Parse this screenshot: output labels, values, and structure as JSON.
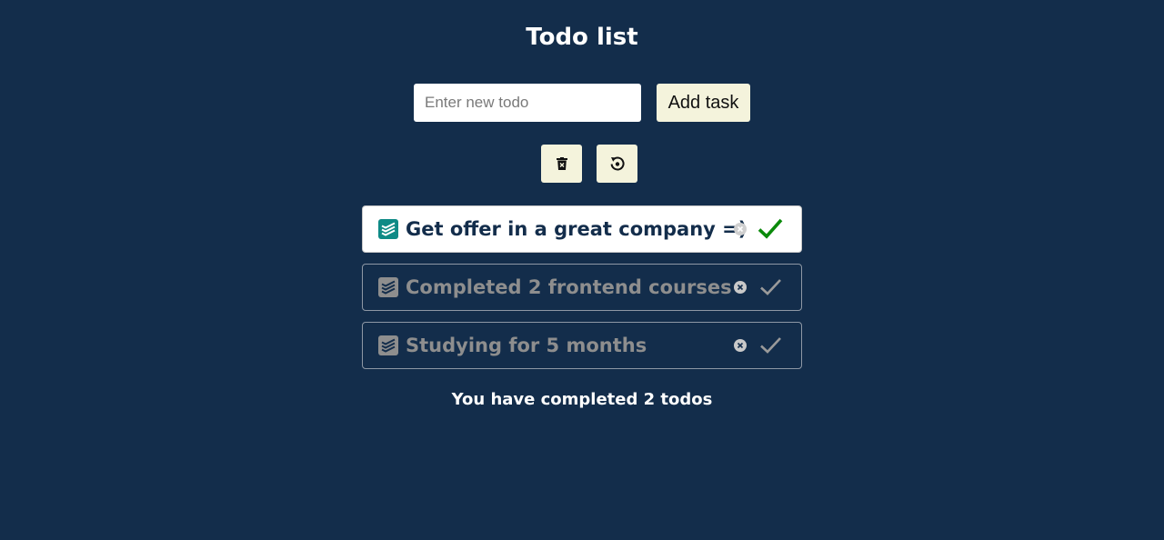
{
  "header": {
    "title": "Todo list"
  },
  "form": {
    "input_placeholder": "Enter new todo",
    "input_value": "",
    "add_label": "Add task"
  },
  "toolbar": {
    "delete_icon": "trash-icon",
    "reset_icon": "reset-icon"
  },
  "todos": [
    {
      "text": "Get offer in a great company =)",
      "completed": false
    },
    {
      "text": "Completed 2 frontend courses",
      "completed": true
    },
    {
      "text": "Studying for 5 months",
      "completed": true
    }
  ],
  "summary": {
    "text": "You have completed 2 todos"
  },
  "colors": {
    "background": "#132d4b",
    "button_bg": "#f4f3dc",
    "accent_teal": "#0e8a86",
    "check_green": "#0b8a0b",
    "muted": "#8e8e8e"
  }
}
